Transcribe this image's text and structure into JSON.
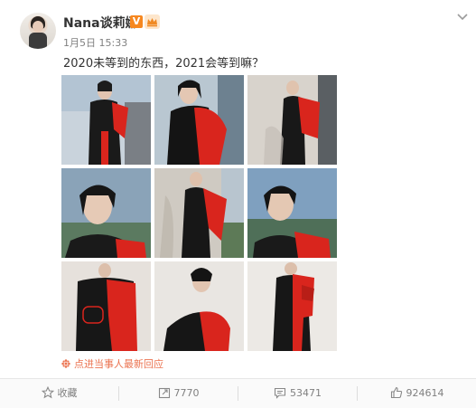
{
  "post": {
    "username": "Nana谈莉娜",
    "verified_badge": "V",
    "timestamp": "1月5日 15:33",
    "text": "2020未等到的东西，2021会等到嘛？",
    "expand_icon": "chevron-down-icon"
  },
  "photos": {
    "count": 9,
    "backgrounds": [
      "#c9d3dc",
      "#b9c7d1",
      "#d8d3cc",
      "#8aa3b8",
      "#cfcac2",
      "#7fa0bf",
      "#e6e1dc",
      "#e9e6e2",
      "#ece9e5"
    ],
    "accent_color": "#d9251d"
  },
  "reply_link": {
    "label": "点进当事人最新回应",
    "icon": "flower-icon",
    "color": "#eb7350"
  },
  "actions": {
    "favorite_label": "收藏",
    "repost_count": "7770",
    "comment_count": "53471",
    "like_count": "924614"
  }
}
